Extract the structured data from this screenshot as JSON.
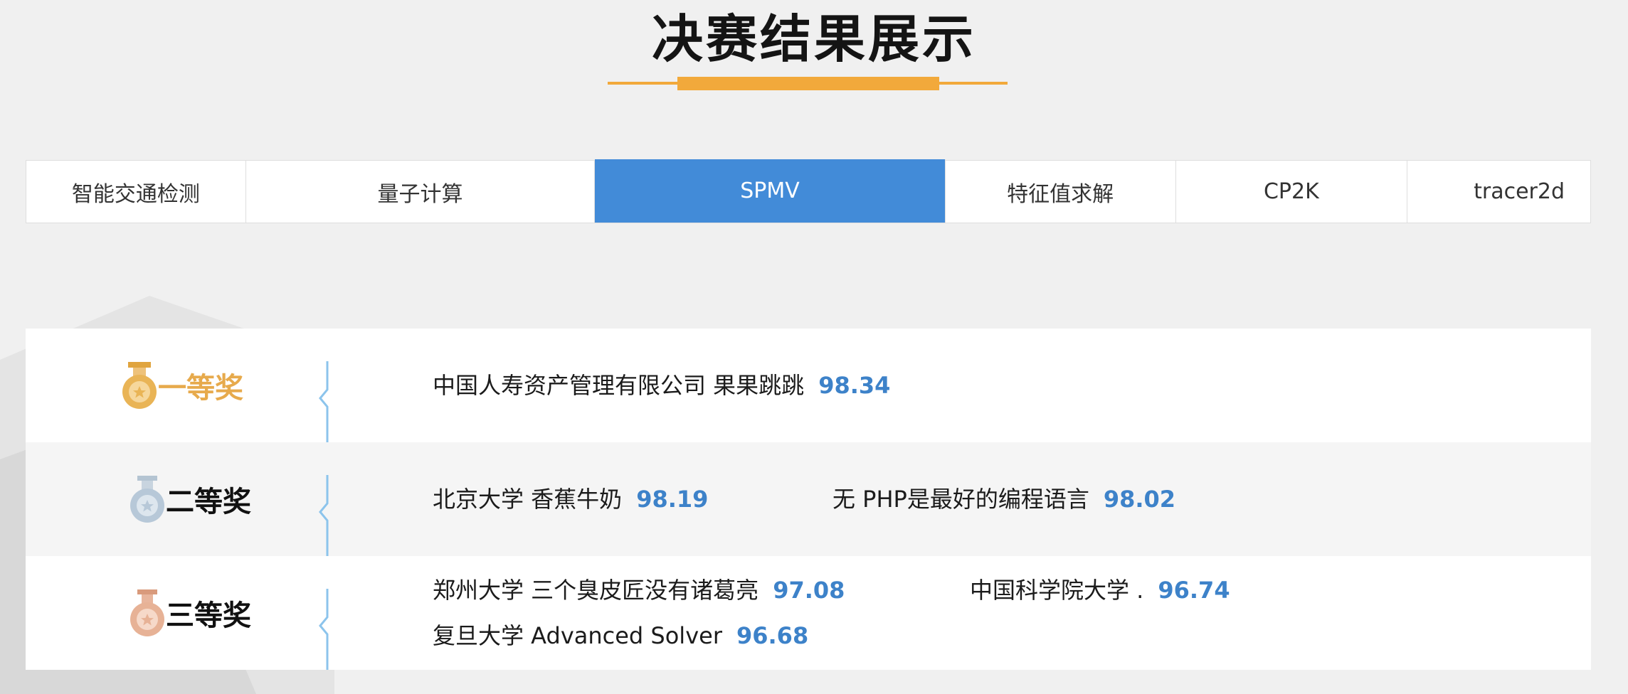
{
  "header": {
    "title": "决赛结果展示"
  },
  "tabs": [
    {
      "label": "智能交通检测",
      "active": false
    },
    {
      "label": "量子计算",
      "active": false
    },
    {
      "label": "SPMV",
      "active": true
    },
    {
      "label": "特征值求解",
      "active": false
    },
    {
      "label": "CP2K",
      "active": false
    },
    {
      "label": "tracer2d",
      "active": false
    }
  ],
  "results": [
    {
      "award": "一等奖",
      "medal": "gold-medal-icon",
      "entries": [
        {
          "team": "中国人寿资产管理有限公司 果果跳跳",
          "score": "98.34"
        }
      ]
    },
    {
      "award": "二等奖",
      "medal": "silver-medal-icon",
      "entries": [
        {
          "team": "北京大学 香蕉牛奶",
          "score": "98.19"
        },
        {
          "team": "无 PHP是最好的编程语言",
          "score": "98.02"
        }
      ]
    },
    {
      "award": "三等奖",
      "medal": "bronze-medal-icon",
      "entries": [
        {
          "team": "郑州大学 三个臭皮匠没有诸葛亮",
          "score": "97.08"
        },
        {
          "team": "中国科学院大学 .",
          "score": "96.74"
        },
        {
          "team": "复旦大学 Advanced Solver",
          "score": "96.68"
        }
      ]
    }
  ],
  "colors": {
    "accent": "#f2a93b",
    "active_tab": "#428bd8",
    "score": "#3d82c9",
    "gold": "#e7aa4c",
    "divider": "#8cc4ec"
  }
}
